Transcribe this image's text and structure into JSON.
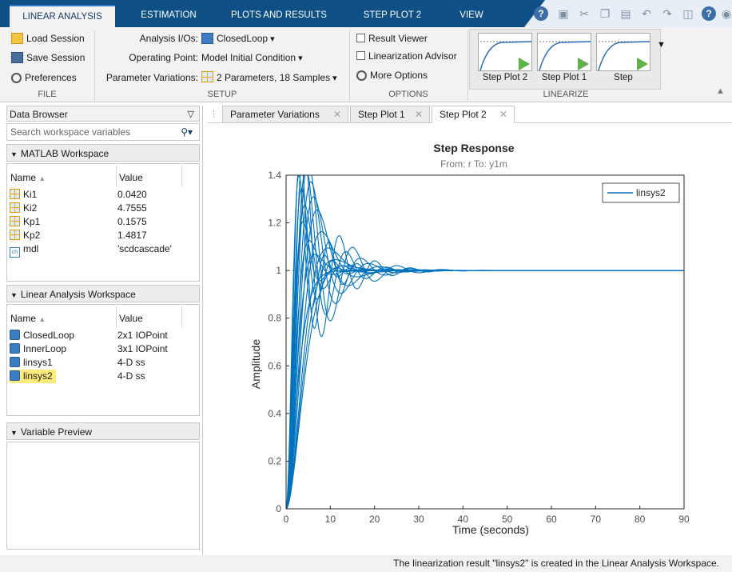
{
  "tabs": [
    "LINEAR ANALYSIS",
    "ESTIMATION",
    "PLOTS AND RESULTS",
    "STEP PLOT 2",
    "VIEW"
  ],
  "ribbon": {
    "file": {
      "load": "Load Session",
      "save": "Save Session",
      "preferences": "Preferences",
      "label": "FILE"
    },
    "setup": {
      "analysis_label": "Analysis I/Os:",
      "analysis_value": "ClosedLoop",
      "op_label": "Operating Point:",
      "op_value": "Model Initial Condition",
      "param_label": "Parameter Variations:",
      "param_value": "2 Parameters, 18 Samples",
      "label": "SETUP"
    },
    "options": {
      "result_viewer": "Result Viewer",
      "lin_advisor": "Linearization Advisor",
      "more": "More Options",
      "label": "OPTIONS"
    },
    "linearize": {
      "tiles": [
        "Step Plot 2",
        "Step Plot 1",
        "Step"
      ],
      "label": "LINEARIZE"
    }
  },
  "left": {
    "title": "Data Browser",
    "search_placeholder": "Search workspace variables",
    "matlab_ws": {
      "title": "MATLAB Workspace",
      "col_name": "Name",
      "col_value": "Value",
      "rows": [
        {
          "name": "Ki1",
          "value": "0.0420"
        },
        {
          "name": "Ki2",
          "value": "4.7555"
        },
        {
          "name": "Kp1",
          "value": "0.1575"
        },
        {
          "name": "Kp2",
          "value": "1.4817"
        },
        {
          "name": "mdl",
          "value": "'scdcascade'"
        }
      ]
    },
    "linear_ws": {
      "title": "Linear Analysis Workspace",
      "col_name": "Name",
      "col_value": "Value",
      "rows": [
        {
          "name": "ClosedLoop",
          "value": "2x1 IOPoint"
        },
        {
          "name": "InnerLoop",
          "value": "3x1 IOPoint"
        },
        {
          "name": "linsys1",
          "value": "4-D ss"
        },
        {
          "name": "linsys2",
          "value": "4-D ss"
        }
      ]
    },
    "preview": {
      "title": "Variable Preview"
    }
  },
  "doc_tabs": [
    "Parameter Variations",
    "Step Plot 1",
    "Step Plot 2"
  ],
  "status": "The linearization result \"linsys2\" is created in the Linear Analysis Workspace.",
  "colors": {
    "line": "#0072bd",
    "tabbar": "#0e4f86"
  },
  "chart_data": {
    "type": "line",
    "title": "Step Response",
    "subtitle": "From: r  To: y1m",
    "xlabel": "Time (seconds)",
    "ylabel": "Amplitude",
    "xlim": [
      0,
      90
    ],
    "ylim": [
      0,
      1.4
    ],
    "xticks": [
      0,
      10,
      20,
      30,
      40,
      50,
      60,
      70,
      80,
      90
    ],
    "yticks": [
      0,
      0.2,
      0.4,
      0.6,
      0.8,
      1,
      1.2,
      1.4
    ],
    "legend": [
      "linsys2"
    ],
    "legend_position": "top-right",
    "series": [
      {
        "name": "linsys2",
        "systems": [
          {
            "peak": 1.35,
            "tpeak": 4.0,
            "zeta": 0.2
          },
          {
            "peak": 1.33,
            "tpeak": 3.2,
            "zeta": 0.22
          },
          {
            "peak": 1.3,
            "tpeak": 5.0,
            "zeta": 0.24
          },
          {
            "peak": 1.28,
            "tpeak": 4.5,
            "zeta": 0.26
          },
          {
            "peak": 1.26,
            "tpeak": 2.9,
            "zeta": 0.28
          },
          {
            "peak": 1.23,
            "tpeak": 5.6,
            "zeta": 0.3
          },
          {
            "peak": 1.2,
            "tpeak": 3.5,
            "zeta": 0.32
          },
          {
            "peak": 1.17,
            "tpeak": 6.2,
            "zeta": 0.35
          },
          {
            "peak": 1.14,
            "tpeak": 4.2,
            "zeta": 0.38
          },
          {
            "peak": 1.12,
            "tpeak": 7.0,
            "zeta": 0.4
          },
          {
            "peak": 1.09,
            "tpeak": 3.8,
            "zeta": 0.45
          },
          {
            "peak": 1.07,
            "tpeak": 8.0,
            "zeta": 0.5
          },
          {
            "peak": 1.05,
            "tpeak": 5.2,
            "zeta": 0.55
          },
          {
            "peak": 1.04,
            "tpeak": 9.5,
            "zeta": 0.6
          },
          {
            "peak": 1.03,
            "tpeak": 6.5,
            "zeta": 0.65
          },
          {
            "peak": 1.02,
            "tpeak": 11.0,
            "zeta": 0.7
          },
          {
            "peak": 1.01,
            "tpeak": 13.0,
            "zeta": 0.78
          },
          {
            "peak": 1.0,
            "tpeak": 16.0,
            "zeta": 0.95
          }
        ]
      }
    ]
  }
}
